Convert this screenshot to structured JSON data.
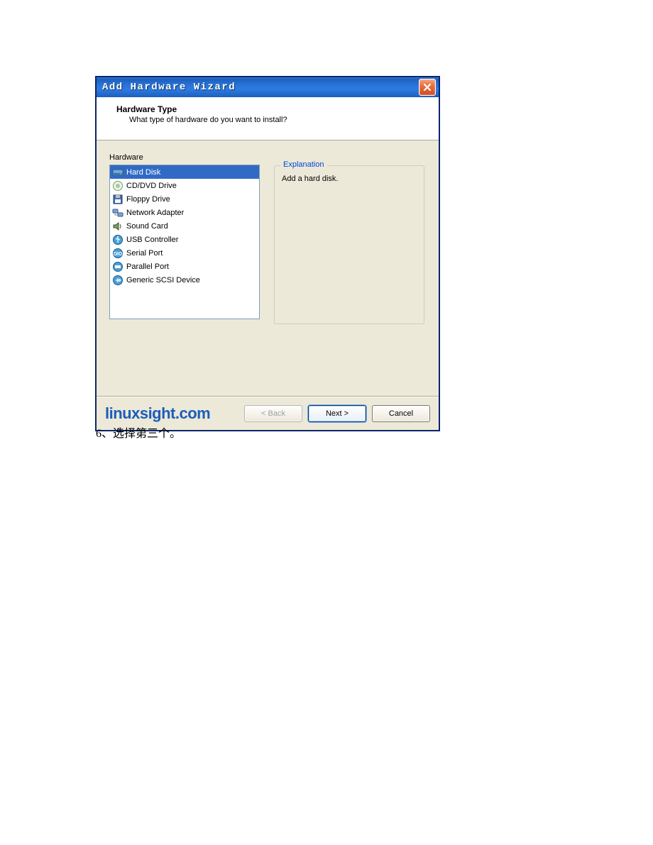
{
  "dialog": {
    "title": "Add Hardware Wizard",
    "header": {
      "title": "Hardware Type",
      "subtitle": "What type of hardware do you want to install?"
    },
    "hardware_label": "Hardware",
    "hardware_items": [
      {
        "label": "Hard Disk",
        "icon": "hdd-icon",
        "selected": true
      },
      {
        "label": "CD/DVD Drive",
        "icon": "cd-icon",
        "selected": false
      },
      {
        "label": "Floppy Drive",
        "icon": "floppy-icon",
        "selected": false
      },
      {
        "label": "Network Adapter",
        "icon": "network-icon",
        "selected": false
      },
      {
        "label": "Sound Card",
        "icon": "sound-icon",
        "selected": false
      },
      {
        "label": "USB Controller",
        "icon": "usb-icon",
        "selected": false
      },
      {
        "label": "Serial Port",
        "icon": "serial-icon",
        "selected": false
      },
      {
        "label": "Parallel Port",
        "icon": "parallel-icon",
        "selected": false
      },
      {
        "label": "Generic SCSI Device",
        "icon": "scsi-icon",
        "selected": false
      }
    ],
    "explanation_label": "Explanation",
    "explanation_text": "Add a hard disk.",
    "watermark": "linuxsight.com",
    "buttons": {
      "back": "< Back",
      "next": "Next >",
      "cancel": "Cancel"
    }
  },
  "caption": "6、选择第三个。"
}
